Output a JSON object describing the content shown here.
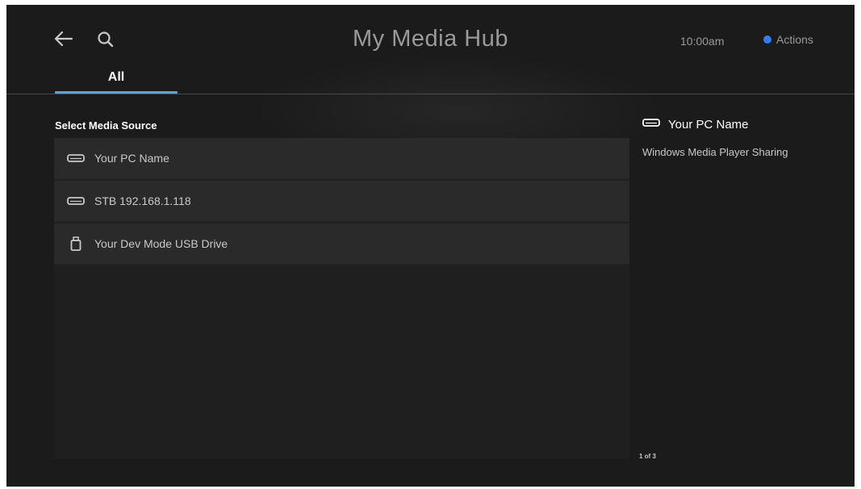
{
  "header": {
    "title": "My Media Hub",
    "time": "10:00am",
    "actions_label": "Actions",
    "actions_dot_color": "#2f7ff7"
  },
  "tabs": [
    {
      "label": "All",
      "selected": true
    }
  ],
  "accent_color": "#4ea7e6",
  "media_sources": {
    "label": "Select Media Source",
    "items": [
      {
        "icon": "hard-drive-icon",
        "label": "Your PC Name"
      },
      {
        "icon": "hard-drive-icon",
        "label": "STB 192.168.1.118"
      },
      {
        "icon": "usb-drive-icon",
        "label": "Your Dev Mode USB Drive"
      }
    ]
  },
  "detail": {
    "icon": "hard-drive-icon",
    "title": "Your PC Name",
    "description": "Windows Media Player Sharing"
  },
  "pager": "1 of 3"
}
